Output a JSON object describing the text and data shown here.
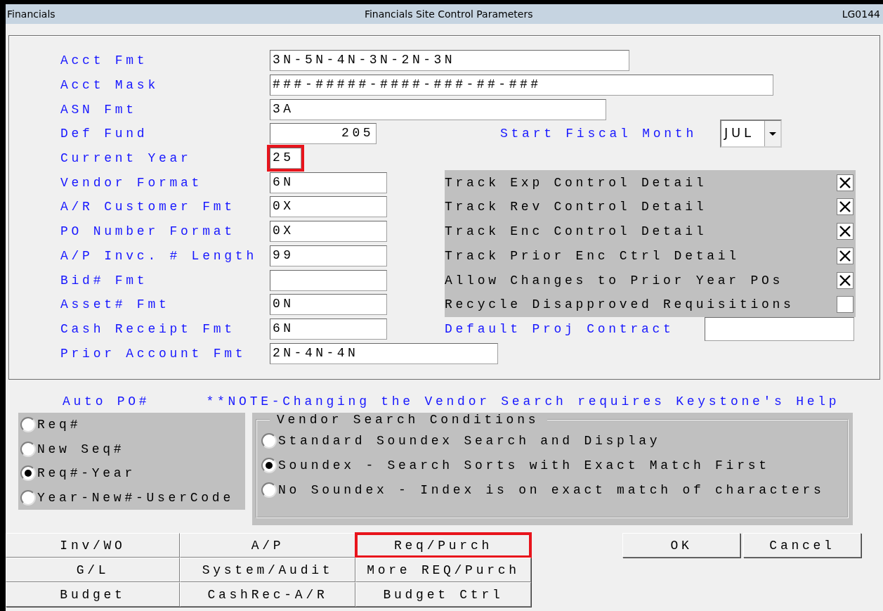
{
  "window": {
    "app": "Financials",
    "title": "Financials Site Control Parameters",
    "code": "LG0144"
  },
  "fields": [
    {
      "label": "Acct Fmt",
      "value": "3N-5N-4N-3N-2N-3N",
      "highlighted": false
    },
    {
      "label": "Acct Mask",
      "value": "###-#####-####-###-##-###",
      "highlighted": false
    },
    {
      "label": "ASN Fmt",
      "value": "3A",
      "highlighted": false
    },
    {
      "label": "Def Fund",
      "value": "205",
      "highlighted": false
    },
    {
      "label": "Current Year",
      "value": "25",
      "highlighted": true
    },
    {
      "label": "Vendor Format",
      "value": "6N",
      "highlighted": false
    },
    {
      "label": "A/R Customer Fmt",
      "value": "0X",
      "highlighted": false
    },
    {
      "label": "PO Number Format",
      "value": "0X",
      "highlighted": false
    },
    {
      "label": "A/P Invc. # Length",
      "value": "99",
      "highlighted": false
    },
    {
      "label": "Bid# Fmt",
      "highlighted": false
    },
    {
      "label": "Asset# Fmt",
      "value": "0N",
      "highlighted": false
    },
    {
      "label": "Cash Receipt Fmt",
      "value": "6N",
      "highlighted": false
    },
    {
      "label": "Prior Account Fmt",
      "value": "2N-4N-4N",
      "highlighted": false
    }
  ],
  "start_fiscal_month": {
    "label": "Start Fiscal Month",
    "value": "JUL"
  },
  "checkboxes": [
    {
      "label": "Track Exp Control Detail",
      "checked": true
    },
    {
      "label": "Track Rev Control Detail",
      "checked": true
    },
    {
      "label": "Track Enc Control Detail",
      "checked": true
    },
    {
      "label": "Track Prior Enc Ctrl Detail",
      "checked": true
    },
    {
      "label": "Allow Changes to Prior Year POs",
      "checked": true
    },
    {
      "label": "Recycle Disapproved Requisitions",
      "checked": false
    }
  ],
  "default_proj_contract": {
    "label": "Default Proj Contract"
  },
  "auto_po": {
    "label": "Auto PO#",
    "options": [
      {
        "label": "Req#",
        "selected": false
      },
      {
        "label": "New Seq#",
        "selected": false
      },
      {
        "label": "Req#-Year",
        "selected": true
      },
      {
        "label": "Year-New#-UserCode",
        "selected": false
      }
    ]
  },
  "note": "**NOTE-Changing the Vendor Search requires Keystone's Help",
  "vendor_search": {
    "title": "Vendor Search Conditions",
    "options": [
      {
        "label": "Standard Soundex Search and Display",
        "selected": false
      },
      {
        "label": "Soundex - Search Sorts with Exact Match First",
        "selected": true
      },
      {
        "label": "No Soundex - Index is on exact match of characters",
        "selected": false
      }
    ]
  },
  "nav_buttons": [
    {
      "label": "Inv/WO",
      "highlighted": false
    },
    {
      "label": "A/P",
      "highlighted": false
    },
    {
      "label": "Req/Purch",
      "highlighted": true
    },
    {
      "label": "G/L",
      "highlighted": false
    },
    {
      "label": "System/Audit",
      "highlighted": false
    },
    {
      "label": "More REQ/Purch",
      "highlighted": false
    },
    {
      "label": "Budget",
      "highlighted": false
    },
    {
      "label": "CashRec-A/R",
      "highlighted": false
    },
    {
      "label": "Budget Ctrl",
      "highlighted": false
    }
  ],
  "dialog_buttons": [
    "OK",
    "Cancel"
  ]
}
